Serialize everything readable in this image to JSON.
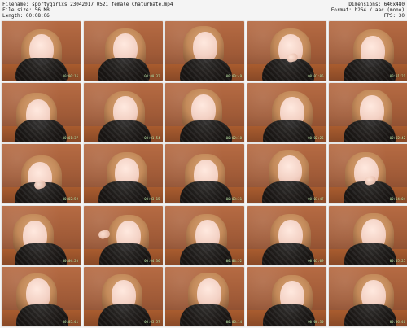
{
  "header": {
    "left_lines": [
      "Filename: sportygirlxs_23042017_0521_female_Chaturbate.mp4",
      "File size: 56 MB",
      "Length: 00:08:06"
    ],
    "right_lines": [
      "Dimensions: 640x480",
      "Format: h264 / aac (mono)",
      "FPS: 30"
    ]
  },
  "thumbnails": [
    {
      "ts": "00:00:16"
    },
    {
      "ts": "00:00:32"
    },
    {
      "ts": "00:00:49"
    },
    {
      "ts": "00:01:05"
    },
    {
      "ts": "00:01:21"
    },
    {
      "ts": "00:01:37"
    },
    {
      "ts": "00:01:54"
    },
    {
      "ts": "00:02:10"
    },
    {
      "ts": "00:02:26"
    },
    {
      "ts": "00:02:42"
    },
    {
      "ts": "00:02:59"
    },
    {
      "ts": "00:03:15"
    },
    {
      "ts": "00:03:31"
    },
    {
      "ts": "00:03:47"
    },
    {
      "ts": "00:04:04"
    },
    {
      "ts": "00:04:20"
    },
    {
      "ts": "00:04:36"
    },
    {
      "ts": "00:04:52"
    },
    {
      "ts": "00:05:09"
    },
    {
      "ts": "00:05:25"
    },
    {
      "ts": "00:05:41"
    },
    {
      "ts": "00:05:57"
    },
    {
      "ts": "00:06:14"
    },
    {
      "ts": "00:06:30"
    },
    {
      "ts": "00:06:46"
    }
  ]
}
